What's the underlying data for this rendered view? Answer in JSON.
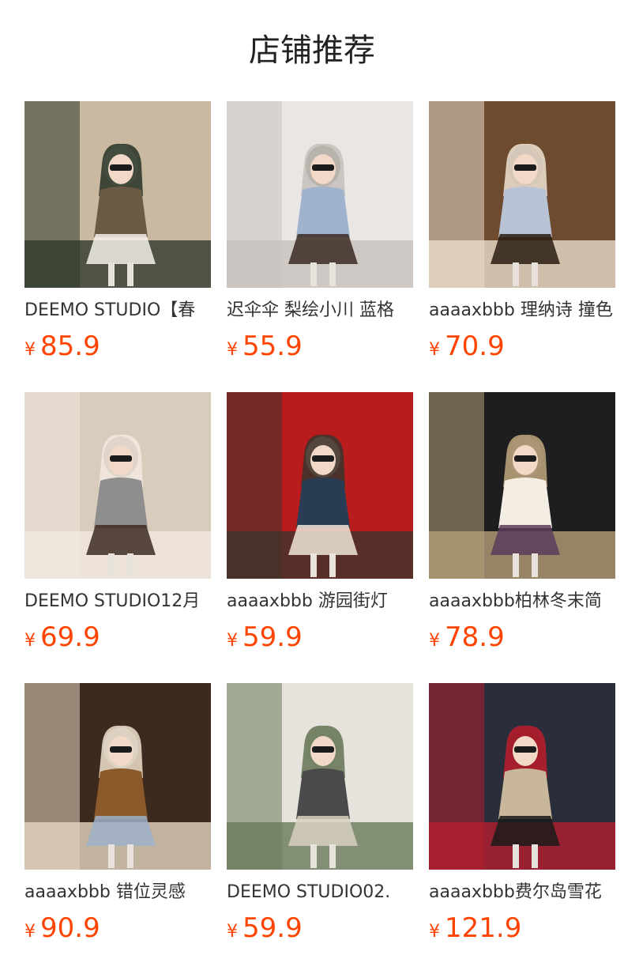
{
  "header": {
    "title": "店铺推荐"
  },
  "products": [
    {
      "name": "DEEMO STUDIO【春",
      "currency": "¥",
      "price": "85.9",
      "photo": "photo-1",
      "colors": [
        "#c9b9a0",
        "#6b5a44",
        "#f4f0ea",
        "#2f3a2c"
      ]
    },
    {
      "name": "迟伞伞 梨绘小川 蓝格",
      "currency": "¥",
      "price": "55.9",
      "photo": "photo-2",
      "colors": [
        "#e9e6e4",
        "#9fb3cc",
        "#3a2a22",
        "#c8c2bd"
      ]
    },
    {
      "name": "aaaaxbbb 理纳诗 撞色",
      "currency": "¥",
      "price": "70.9",
      "photo": "photo-3",
      "colors": [
        "#6e4a2e",
        "#b9c3d6",
        "#2b1c12",
        "#e8dccb"
      ]
    },
    {
      "name": "DEEMO STUDIO12月",
      "currency": "¥",
      "price": "69.9",
      "photo": "photo-4",
      "colors": [
        "#d9ccbd",
        "#8e8e8e",
        "#3d2c22",
        "#f1e8de"
      ]
    },
    {
      "name": "aaaaxbbb 游园街灯",
      "currency": "¥",
      "price": "59.9",
      "photo": "photo-5",
      "colors": [
        "#b81c1c",
        "#2a3c54",
        "#efe6d8",
        "#40342c"
      ]
    },
    {
      "name": "aaaaxbbb柏林冬末简",
      "currency": "¥",
      "price": "78.9",
      "photo": "photo-6",
      "colors": [
        "#1e1e20",
        "#f3ede3",
        "#5a3c5a",
        "#b59e78"
      ]
    },
    {
      "name": "aaaaxbbb 错位灵感",
      "currency": "¥",
      "price": "90.9",
      "photo": "photo-7",
      "colors": [
        "#3c2a1e",
        "#8b5a2b",
        "#9fb0c8",
        "#e3d6c1"
      ]
    },
    {
      "name": "DEEMO STUDIO02.",
      "currency": "¥",
      "price": "59.9",
      "photo": "photo-8",
      "colors": [
        "#e6e2dc",
        "#4a4a4a",
        "#d8d0c0",
        "#6a7a5a"
      ]
    },
    {
      "name": "aaaaxbbb费尔岛雪花",
      "currency": "¥",
      "price": "121.9",
      "photo": "photo-9",
      "colors": [
        "#2a2e3a",
        "#c9b79c",
        "#1a1a1a",
        "#b31e2e"
      ]
    }
  ]
}
